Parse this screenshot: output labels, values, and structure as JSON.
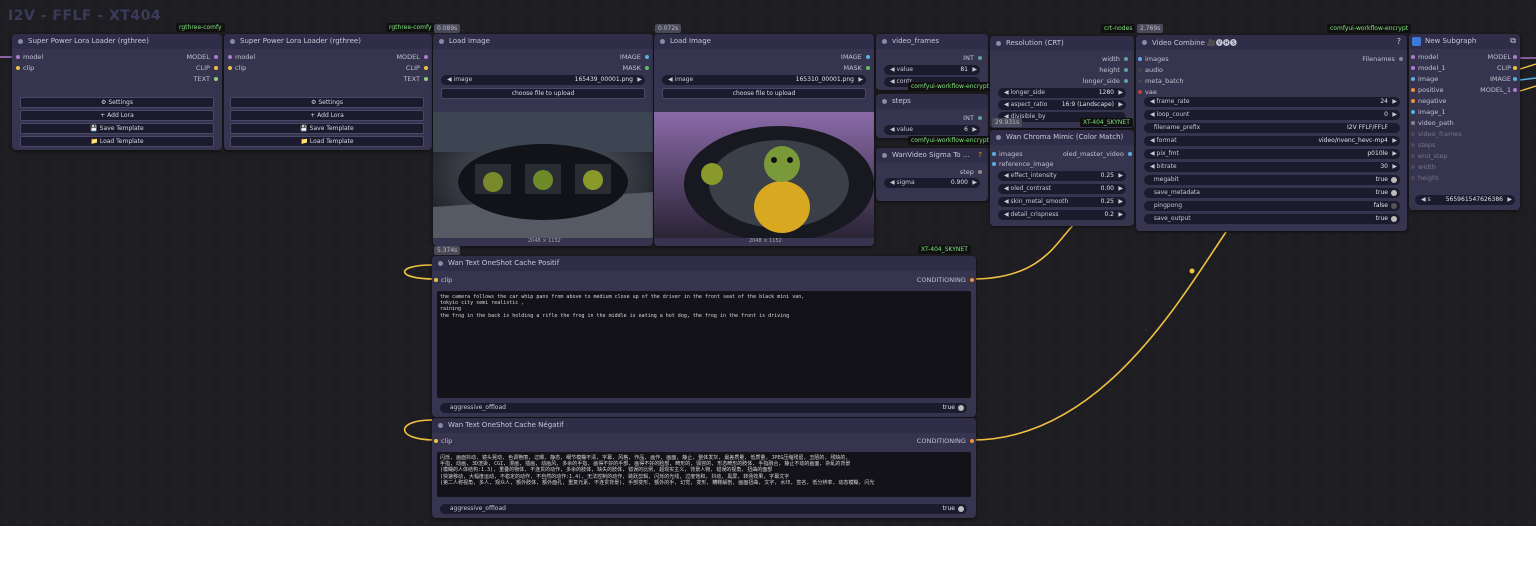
{
  "group_title": "I2V - FFLF - XT404",
  "badges": {
    "rgthree1": "rgthree-comfy",
    "rgthree2": "rgthree-comfy",
    "crt": "crt-nodes",
    "encrypt": "comfyui-workflow-encrypt",
    "encrypt2": "comfyui-workflow-encrypt",
    "encrypt3": "comfyui-workflow-encrypt",
    "skynet1": "XT-404_SKYNET",
    "skynet2": "XT-404_SKYNET"
  },
  "timers": {
    "load1": "0.089s",
    "load2": "0.072s",
    "crt": "2.769s",
    "pos": "5.374s",
    "chroma": "29.931s"
  },
  "lora1": {
    "title": "Super Power Lora Loader (rgthree)",
    "in_model": "model",
    "in_clip": "clip",
    "out_model": "MODEL",
    "out_clip": "CLIP",
    "out_text": "TEXT",
    "settings": "⚙ Settings",
    "add": "+ Add Lora",
    "save": "💾 Save Template",
    "load": "📁 Load Template"
  },
  "lora2": {
    "title": "Super Power Lora Loader (rgthree)",
    "in_model": "model",
    "in_clip": "clip",
    "out_model": "MODEL",
    "out_clip": "CLIP",
    "out_text": "TEXT",
    "settings": "⚙ Settings",
    "add": "+ Add Lora",
    "save": "💾 Save Template",
    "load": "📁 Load Template"
  },
  "load1": {
    "title": "Load Image",
    "out_image": "IMAGE",
    "out_mask": "MASK",
    "image_label": "image",
    "image_value": "165439_00001.png",
    "upload": "choose file to upload",
    "caption": "2048 × 1152"
  },
  "load2": {
    "title": "Load Image",
    "out_image": "IMAGE",
    "out_mask": "MASK",
    "image_label": "image",
    "image_value": "165310_00001.png",
    "upload": "choose file to upload",
    "caption": "2048 × 1152"
  },
  "video_frames": {
    "title": "video_frames",
    "out": "INT",
    "label": "value",
    "value": "81",
    "partial": "contr"
  },
  "steps": {
    "title": "steps",
    "out": "INT",
    "label": "value",
    "value": "6"
  },
  "sigma": {
    "title": "WanVideo Sigma To ...",
    "out": "step",
    "label": "sigma",
    "value": "0.900"
  },
  "resolution": {
    "title": "Resolution (CRT)",
    "out_width": "width",
    "out_height": "height",
    "out_longer": "longer_side",
    "w_longer": "longer_side",
    "w_longer_val": "1280",
    "w_aspect": "aspect_ratio",
    "w_aspect_val": "16:9 (Landscape)",
    "w_div": "divisible_by"
  },
  "chroma": {
    "title": "Wan Chroma Mimic (Color Match)",
    "in_images": "images",
    "in_ref": "reference_image",
    "out": "oled_master_video",
    "w1": "effect_intensity",
    "v1": "0.25",
    "w2": "oled_contrast",
    "v2": "0.00",
    "w3": "skin_metal_smooth",
    "v3": "0.25",
    "w4": "detail_crispness",
    "v4": "0.2"
  },
  "combine": {
    "title": "Video Combine 🎥🅥🅗🅢",
    "in_images": "images",
    "in_audio": "audio",
    "in_meta": "meta_batch",
    "in_vae": "vae",
    "out": "Filenames",
    "w_frame": "frame_rate",
    "v_frame": "24",
    "w_loop": "loop_count",
    "v_loop": "0",
    "w_prefix": "filename_prefix",
    "v_prefix": "I2V FFLF/FFLF",
    "w_format": "format",
    "v_format": "video/nvenc_hevc-mp4",
    "w_pix": "pix_fmt",
    "v_pix": "p010le",
    "w_bitrate": "bitrate",
    "v_bitrate": "30",
    "w_megabit": "megabit",
    "v_megabit": "true",
    "w_meta": "save_metadata",
    "v_meta": "true",
    "w_ping": "pingpong",
    "v_ping": "false",
    "w_save": "save_output",
    "v_save": "true"
  },
  "subgraph": {
    "title": "New Subgraph",
    "inputs": [
      "model",
      "model_1",
      "image",
      "positive",
      "negative",
      "image_1",
      "video_path",
      "video_frames",
      "steps",
      "end_step",
      "width",
      "height"
    ],
    "outputs": [
      "MODEL",
      "CLIP",
      "IMAGE",
      "MODEL_1"
    ],
    "seed_label": "s",
    "seed_value": "565961547626386"
  },
  "positive": {
    "title": "Wan Text OneShot Cache Positif",
    "in_clip": "clip",
    "out": "CONDITIONING",
    "text": "the camera follows the car whip pans from above to medium close up of the driver in the front seat of the black mini van,\ntokyio city semi realistic ,\nraining\nthe frog in the back is holding a rifle the frog in the middle is eating a hot dog, the frog in the front is driving",
    "offload": "aggressive_offload",
    "offload_val": "true"
  },
  "negative": {
    "title": "Wan Text OneShot Cache Négatif",
    "in_clip": "clip",
    "out": "CONDITIONING",
    "text": "闪烁, 画面抖动, 镜头晃动, 色调艳丽, 过曝, 静态, 细节模糊不清, 字幕, 风格, 作品, 画作, 画面, 静止, 整体发灰, 最差质量, 低质量, JPEG压缩残留, 丑陋的, 残缺的,\n手指, 动画, 3D渲染, CGI, 漫画, 插画, 动画风, 多余的手指, 画得不好的手部, 画得不好的脸部, 畸形的, 毁容的, 形态畸形的肢体, 手指融合, 静止不动的画面, 杂乱的背景\n(模糊的人体结构:1.3), 重叠的物体, 不连贯的动作, 多余的肢体, 缺失的肢体, 错误的比例, 超现实主义, 背景人物, 错误的视角, 扭曲的面部\n(快速移动, 大幅度运动, 不稳定的动作, 不自然的动作:1.4), 无法控制的动作, 跳跃剪辑, 闪烁的光线, 过度饱和, 抖动, 黑屏, 转场效果, 字幕文字\n(第二人称视角, 多人, 观众人, 额外肢体, 额外面孔, 重复元素, 不连贯背景), 手部变形, 额外的手, 幻觉, 变形, 糟糕解剖, 画面扭曲, 文字, 水印, 签名, 低分辨率, 动态模糊, 闪光",
    "offload": "aggressive_offload",
    "offload_val": "true"
  }
}
